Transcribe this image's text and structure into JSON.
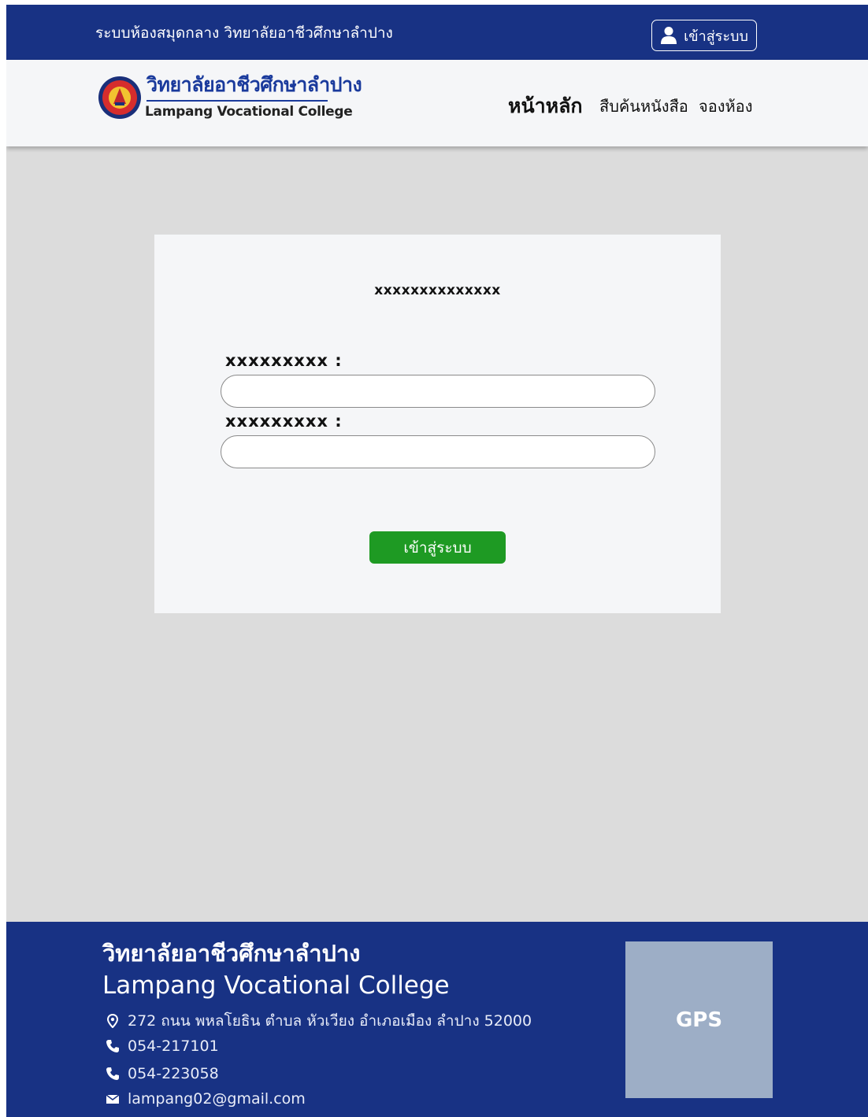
{
  "topbar": {
    "title": "ระบบห้องสมุดกลาง วิทยาลัยอาชีวศึกษาลำปาง",
    "login_label": "เข้าสู่ระบบ",
    "login_icon": "user-icon"
  },
  "header": {
    "brand_th": "วิทยาลัยอาชีวศึกษาลำปาง",
    "brand_en": "Lampang Vocational College",
    "nav": {
      "home": "หน้าหลัก",
      "search": "สืบค้นหนังสือ",
      "book": "จองห้อง"
    }
  },
  "card": {
    "title": "xxxxxxxxxxxxxx",
    "label1": "xxxxxxxxx :",
    "label2": "xxxxxxxxx :",
    "field1_value": "",
    "field2_value": "",
    "submit_label": "เข้าสู่ระบบ"
  },
  "footer": {
    "name_th": "วิทยาลัยอาชีวศึกษาลำปาง",
    "name_en": "Lampang Vocational College",
    "address": "272 ถนน พหลโยธิน ตำบล หัวเวียง อำเภอเมือง ลำปาง 52000",
    "phone1": "054-217101",
    "phone2": "054-223058",
    "email": "lampang02@gmail.com",
    "map_label": "GPS"
  },
  "colors": {
    "primary": "#183284",
    "brand_text": "#1a3a9c",
    "button": "#1e9a23",
    "page_bg": "#dcdcdc",
    "card_bg": "#f5f6f8",
    "map_box": "#9daec6"
  }
}
